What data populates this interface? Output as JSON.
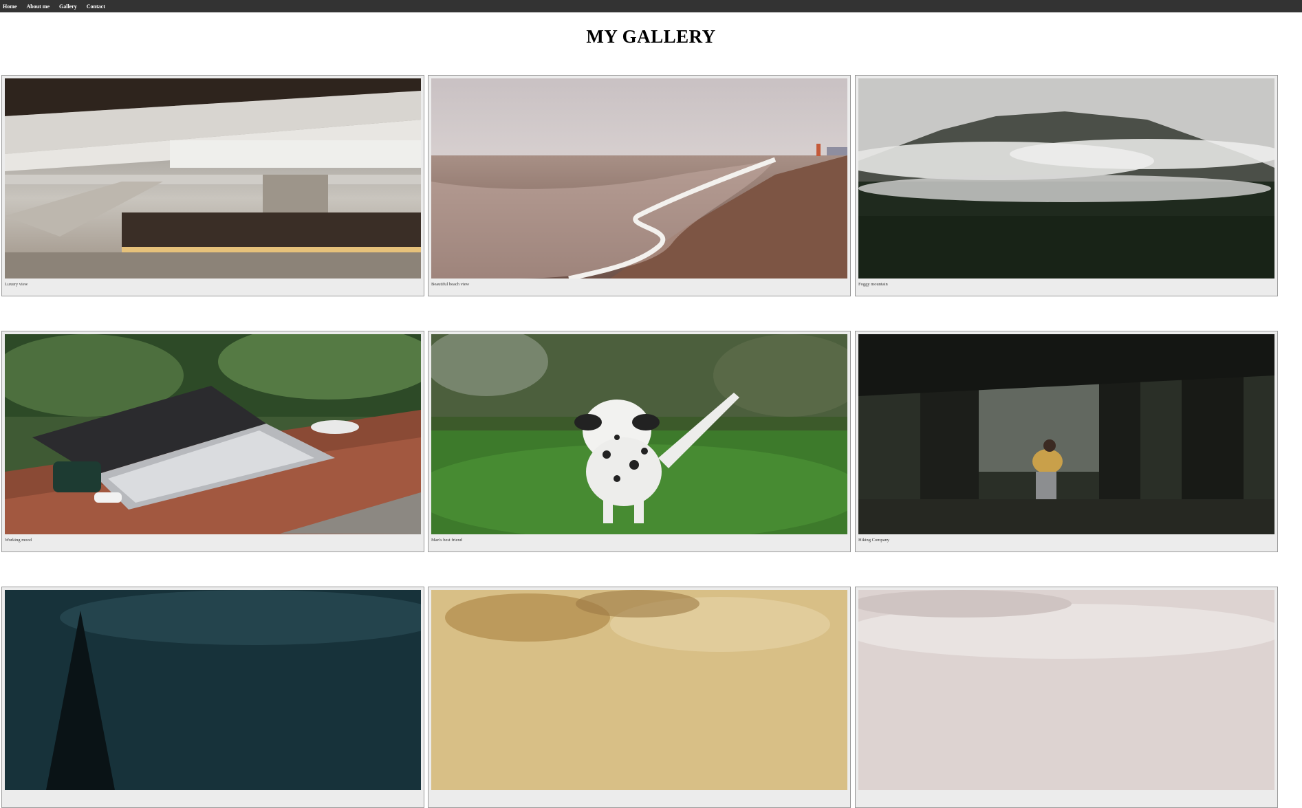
{
  "nav": {
    "links": [
      "Home",
      "About me",
      "Gallery",
      "Contact"
    ]
  },
  "header": {
    "title": "MY GALLERY"
  },
  "gallery": {
    "items": [
      {
        "caption": "Luxury view"
      },
      {
        "caption": "Beautiful beach view"
      },
      {
        "caption": "Foggy mountain"
      },
      {
        "caption": "Working mood"
      },
      {
        "caption": "Man's best friend"
      },
      {
        "caption": "Hiking Company"
      },
      {
        "caption": ""
      },
      {
        "caption": ""
      },
      {
        "caption": ""
      }
    ]
  },
  "colors": {
    "navbar": "#333333",
    "card_background": "#ececec",
    "card_border": "#9a9a9a"
  }
}
